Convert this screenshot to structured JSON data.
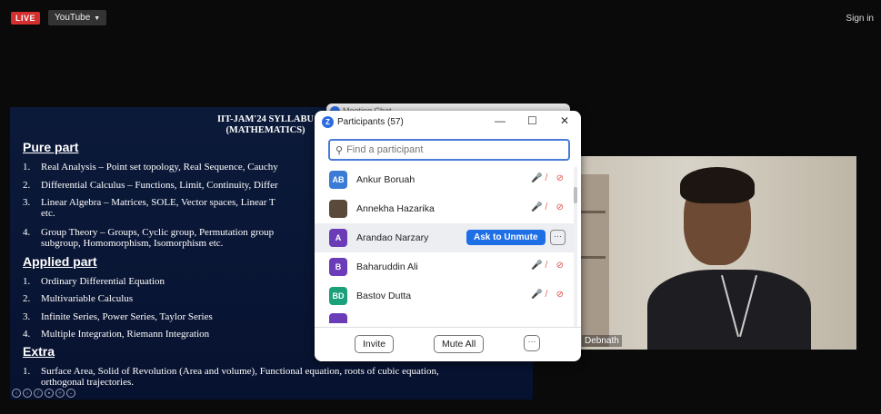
{
  "topbar": {
    "live": "LIVE",
    "source": "YouTube",
    "caret": "▼",
    "sign_in": "Sign in"
  },
  "slide": {
    "title_line1": "IIT-JAM'24 SYLLABU",
    "title_line2": "(MATHEMATICS)",
    "pure_head": "Pure part",
    "pure_items": [
      {
        "num": "1.",
        "text": "Real Analysis – Point set topology, Real Sequence, Cauchy"
      },
      {
        "num": "2.",
        "text": "Differential Calculus – Functions, Limit, Continuity, Differ"
      },
      {
        "num": "3.",
        "text": "Linear Algebra – Matrices, SOLE, Vector spaces, Linear T",
        "cont": "etc."
      },
      {
        "num": "4.",
        "text": "Group Theory – Groups, Cyclic group, Permutation group",
        "cont": "subgroup, Homomorphism, Isomorphism etc."
      }
    ],
    "applied_head": "Applied part",
    "applied_items": [
      {
        "num": "1.",
        "text": "Ordinary Differential Equation"
      },
      {
        "num": "2.",
        "text": "Multivariable Calculus"
      },
      {
        "num": "3.",
        "text": "Infinite Series, Power Series, Taylor Series"
      },
      {
        "num": "4.",
        "text": "Multiple Integration, Riemann Integration"
      }
    ],
    "extra_head": "Extra",
    "extra_items": [
      {
        "num": "1.",
        "text": "Surface Area, Solid of Revolution (Area and volume), Functional equation, roots of cubic equation,",
        "cont": "orthogonal trajectories."
      }
    ]
  },
  "webcam": {
    "name": "Debnath"
  },
  "chat": {
    "title": "Meeting Chat"
  },
  "participants": {
    "logo": "Z",
    "title": "Participants (57)",
    "minimize": "—",
    "maximize": "☐",
    "close": "✕",
    "search_placeholder": "Find a participant",
    "list": [
      {
        "initials": "AB",
        "name": "Ankur Boruah",
        "color": "#3a7bd5"
      },
      {
        "initials": "",
        "name": "Annekha Hazarika",
        "color": "#5a4a3a"
      },
      {
        "initials": "A",
        "name": "Arandao Narzary",
        "color": "#6a3cb8"
      },
      {
        "initials": "B",
        "name": "Baharuddin Ali",
        "color": "#6a3cb8"
      },
      {
        "initials": "BD",
        "name": "Bastov Dutta",
        "color": "#1aa07a"
      }
    ],
    "ask_unmute": "Ask to Unmute",
    "more": "···",
    "invite": "Invite",
    "mute_all": "Mute All"
  },
  "colors": {
    "accent": "#1e6ee6",
    "muted": "#e0504a",
    "slide_bg": "#0c1a3a"
  }
}
